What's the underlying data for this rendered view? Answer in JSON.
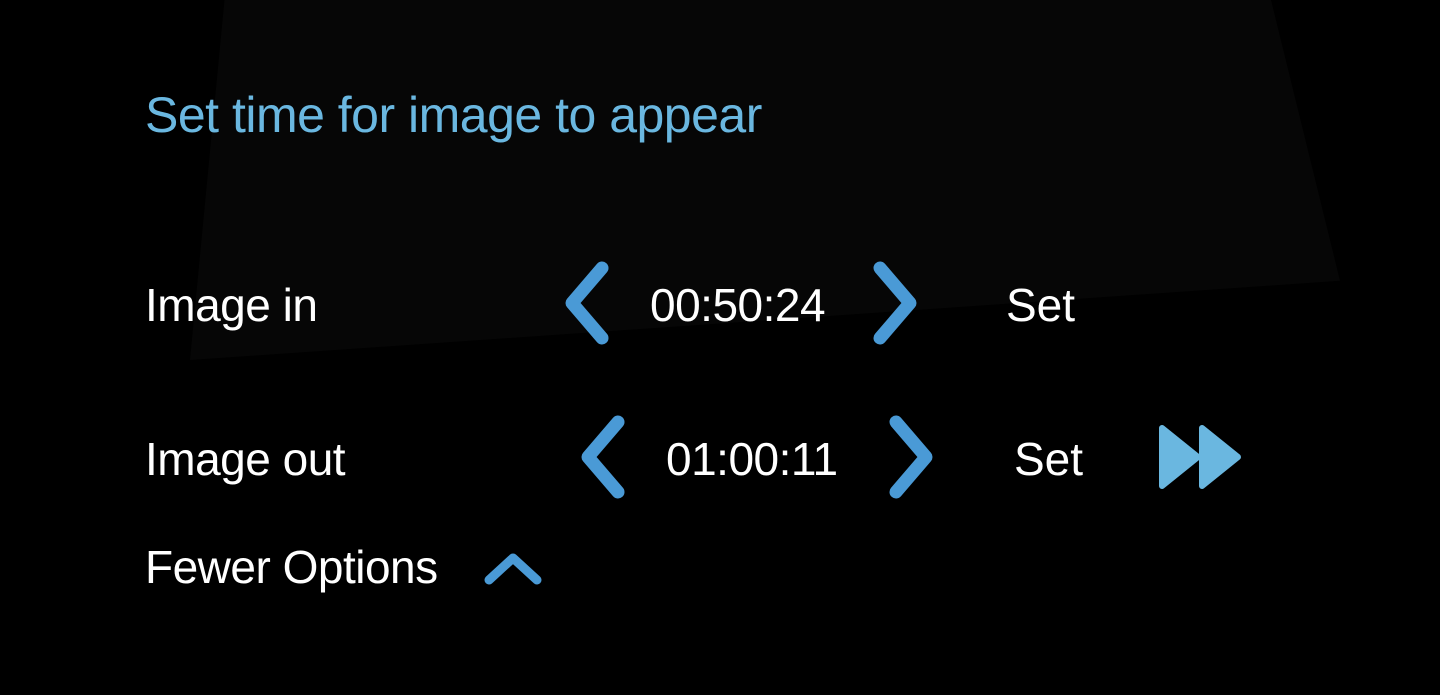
{
  "panel": {
    "title": "Set time for image to appear"
  },
  "image_in": {
    "label": "Image in",
    "time": "00:50:24",
    "set_label": "Set",
    "decrement_icon": "chevron-left-icon",
    "increment_icon": "chevron-right-icon"
  },
  "image_out": {
    "label": "Image out",
    "time": "01:00:11",
    "set_label": "Set",
    "decrement_icon": "chevron-left-icon",
    "increment_icon": "chevron-right-icon",
    "extra_icon": "fast-forward-icon"
  },
  "options": {
    "toggle_label": "Fewer Options",
    "toggle_icon": "chevron-up-icon"
  },
  "colors": {
    "accent": "#6ab7e0",
    "chevron": "#4a9ad6",
    "background": "#000000",
    "text": "#ffffff"
  }
}
